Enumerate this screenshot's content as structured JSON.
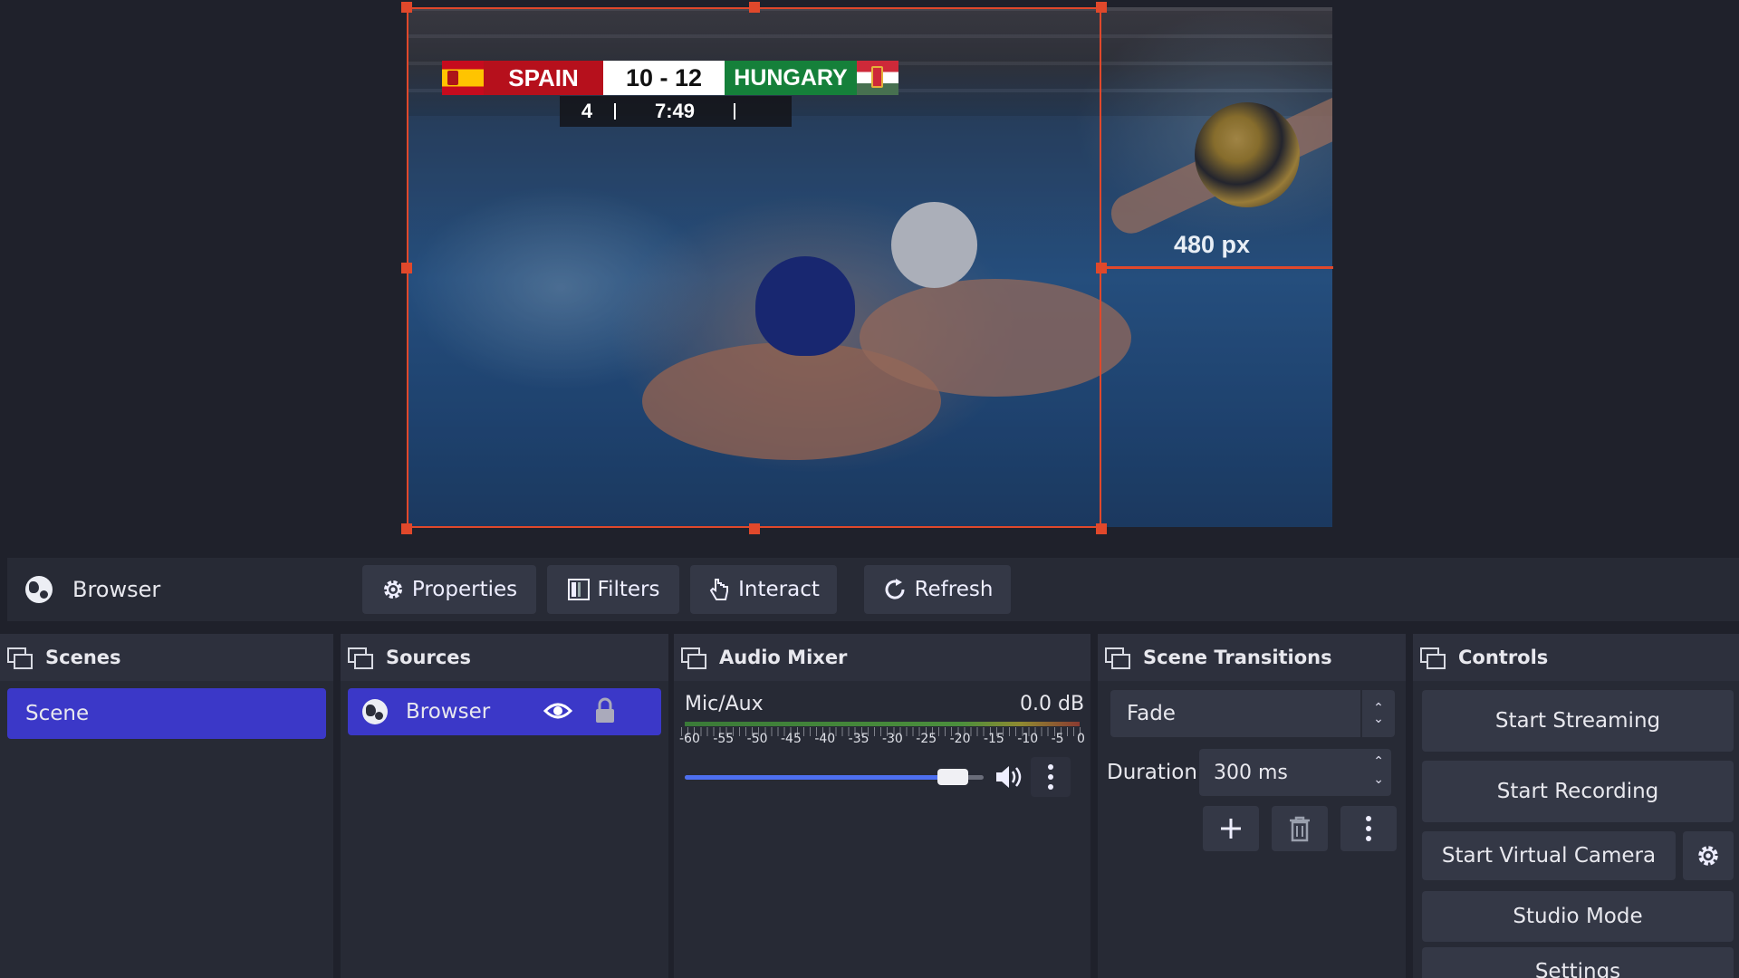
{
  "preview": {
    "scoreboard": {
      "team_left": "SPAIN",
      "score": "10 - 12",
      "team_right": "HUNGARY",
      "period": "4",
      "clock": "7:49"
    },
    "dimension_label": "480 px",
    "selection_color": "#e0482b"
  },
  "source_toolbar": {
    "source_name": "Browser",
    "properties": "Properties",
    "filters": "Filters",
    "interact": "Interact",
    "refresh": "Refresh"
  },
  "docks": {
    "scenes": {
      "title": "Scenes",
      "items": [
        "Scene"
      ]
    },
    "sources": {
      "title": "Sources",
      "items": [
        {
          "label": "Browser"
        }
      ]
    },
    "audio_mixer": {
      "title": "Audio Mixer",
      "channel": "Mic/Aux",
      "level": "0.0 dB",
      "ticks": [
        "-60",
        "-55",
        "-50",
        "-45",
        "-40",
        "-35",
        "-30",
        "-25",
        "-20",
        "-15",
        "-10",
        "-5",
        "0"
      ],
      "volume_fraction": 0.93
    },
    "scene_transitions": {
      "title": "Scene Transitions",
      "transition": "Fade",
      "duration_label": "Duration",
      "duration_value": "300 ms"
    },
    "controls": {
      "title": "Controls",
      "start_streaming": "Start Streaming",
      "start_recording": "Start Recording",
      "start_virtual_camera": "Start Virtual Camera",
      "studio_mode": "Studio Mode",
      "settings": "Settings"
    }
  },
  "colors": {
    "accent": "#3b38c8",
    "panel": "#272a35",
    "button": "#343846"
  }
}
